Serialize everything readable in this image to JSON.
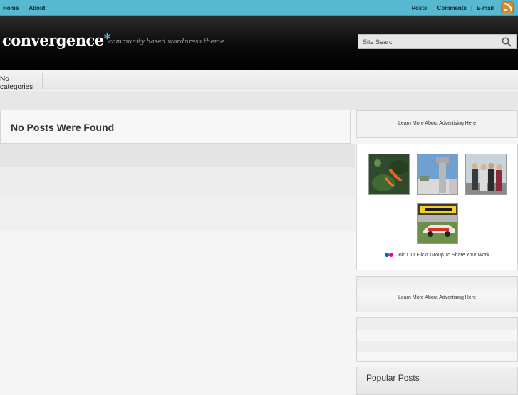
{
  "topnav": {
    "left": [
      "Home",
      "About"
    ],
    "right": [
      "Posts",
      "Comments",
      "E-mail"
    ],
    "separator": "|"
  },
  "header": {
    "logo": "convergence",
    "logo_mark": "*",
    "tagline": "community based wordpress theme",
    "search_placeholder": "Site Search"
  },
  "categories": {
    "label": "No categories"
  },
  "main": {
    "heading": "No Posts Were Found"
  },
  "sidebar": {
    "ad_top": "Learn More About Advertising Here",
    "flickr_caption": "Join Our Flickr Group To Share Your Work",
    "ad_bottom": "Learn More About Advertising Here",
    "popular_title": "Popular Posts"
  },
  "colors": {
    "topbar": "#58b8cf",
    "accent": "#4fc3e0",
    "flickr_blue": "#0063dc",
    "flickr_pink": "#ff0084"
  }
}
